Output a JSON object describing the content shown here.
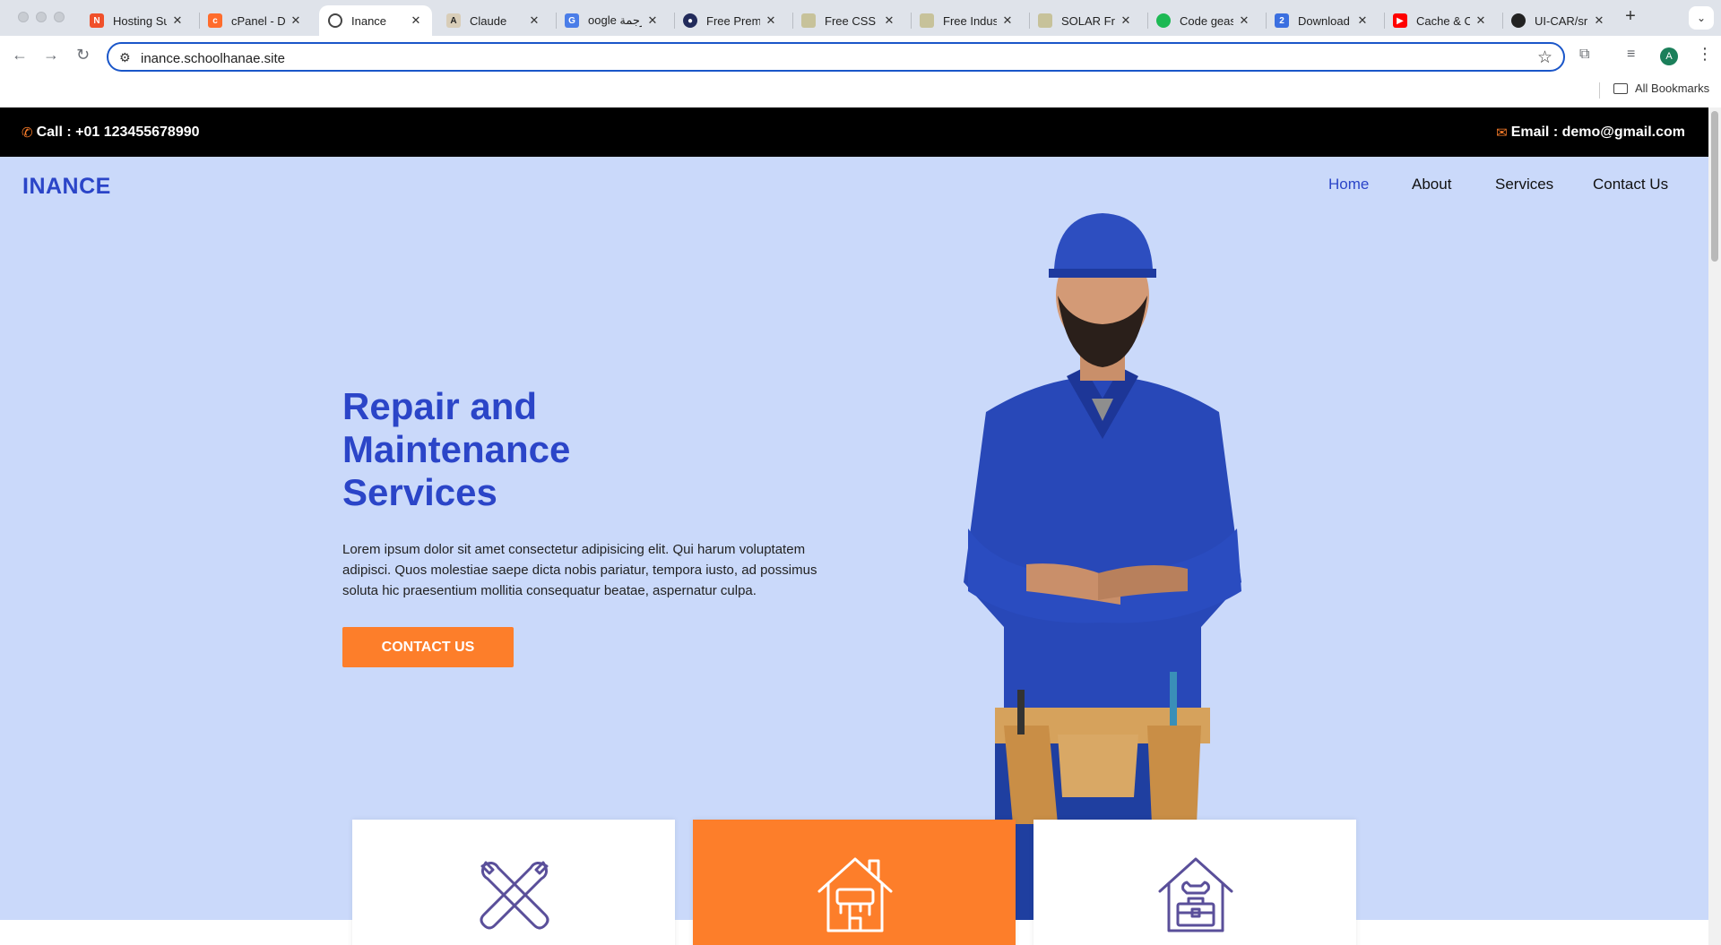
{
  "browser": {
    "tabs": [
      {
        "title": "Hosting Su",
        "favicon": "hosting-icon",
        "color": "#f0502a"
      },
      {
        "title": "cPanel - D",
        "favicon": "cpanel-icon",
        "color": "#ff6c2c"
      },
      {
        "title": "Inance",
        "favicon": "globe-icon",
        "color": "#444444"
      },
      {
        "title": "Claude",
        "favicon": "anthropic-icon",
        "color": "#2b2b2b"
      },
      {
        "title": "oogle ترجمة",
        "favicon": "translate-icon",
        "color": "#4a7de8"
      },
      {
        "title": "Free Premi",
        "favicon": "free-premium-icon",
        "color": "#222b5b"
      },
      {
        "title": "Free CSS |",
        "favicon": "freecss-icon",
        "color": "#c7c29a"
      },
      {
        "title": "Free Indus",
        "favicon": "freecss-icon",
        "color": "#c7c29a"
      },
      {
        "title": "SOLAR Fre",
        "favicon": "freecss-icon",
        "color": "#c7c29a"
      },
      {
        "title": "Code geas",
        "favicon": "spotify-icon",
        "color": "#1db954"
      },
      {
        "title": "Download",
        "favicon": "doc-icon",
        "color": "#3b6fe0"
      },
      {
        "title": "Cache & C",
        "favicon": "youtube-icon",
        "color": "#ff0000"
      },
      {
        "title": "UI-CAR/sr",
        "favicon": "github-icon",
        "color": "#222222"
      }
    ],
    "url": "inance.schoolhanae.site",
    "bookmarks_label": "All Bookmarks",
    "avatar_letter": "A"
  },
  "topbar": {
    "call": "Call : +01 123455678990",
    "email": "Email : demo@gmail.com"
  },
  "header": {
    "logo": "INANCE",
    "nav": [
      "Home",
      "About",
      "Services",
      "Contact Us"
    ]
  },
  "hero": {
    "title": "Repair and Maintenance Services",
    "text": "Lorem ipsum dolor sit amet consectetur adipisicing elit. Qui harum voluptatem adipisci. Quos molestiae saepe dicta nobis pariatur, tempora iusto, ad possimus soluta hic praesentium mollitia consequatur beatae, aspernatur culpa.",
    "cta": "CONTACT US"
  },
  "cards": [
    {
      "icon": "wrench-cross-icon"
    },
    {
      "icon": "house-paint-icon"
    },
    {
      "icon": "house-toolbox-icon"
    }
  ],
  "colors": {
    "accent": "#fd7e2a",
    "brand": "#2b45c8",
    "hero_bg": "#cad9fa"
  }
}
